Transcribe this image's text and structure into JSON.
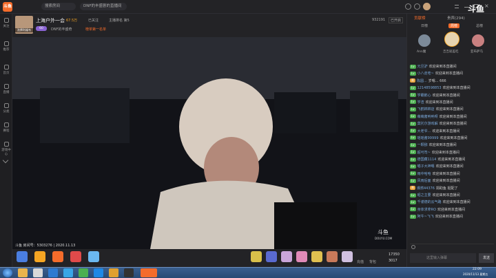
{
  "topbar": {
    "brand": "斗鱼",
    "search_placeholder": "搜索房间",
    "tabs": [
      "DNF的丰盛剧的直播间",
      "斗鱼"
    ],
    "right_icons": [
      "gamepad-icon",
      "bell-icon",
      "clock-icon",
      "share-icon"
    ]
  },
  "sidebar": {
    "items": [
      {
        "label": "关注",
        "icon": "heart-icon"
      },
      {
        "label": "推荐",
        "icon": "star-icon"
      },
      {
        "label": "首页",
        "icon": "home-icon"
      },
      {
        "label": "直播",
        "icon": "tv-icon"
      },
      {
        "label": "分类",
        "icon": "grid-icon"
      },
      {
        "label": "赛程",
        "icon": "calendar-icon"
      },
      {
        "label": "游戏中心",
        "icon": "gamepad-icon"
      }
    ]
  },
  "room": {
    "title": "上海户外一会",
    "avatar_label": "洗牌利福韦",
    "level_badge": "60",
    "fans": "67.5万",
    "followers": "已关注",
    "category": "DNF的丰盛奇",
    "heat_label": "榜单第一名单",
    "extra": "主播排名 第5",
    "follow_btn": "关注",
    "resolution": "蓝光",
    "stats": "932191",
    "quality": "已开启"
  },
  "video": {
    "watermark": "斗鱼",
    "watermark_sub": "DOUYU.COM",
    "room_line": "斗鱼 房间号：5303276 | 2020.11.13"
  },
  "bottom": {
    "gifts_left": [
      "热度",
      "热榜",
      "宝箱",
      "神秘人",
      "充值礼包"
    ],
    "coins": "17350",
    "coins2": "3017",
    "recharge": "充值",
    "backpack": "背包"
  },
  "right": {
    "logo": "斗鱼",
    "logo_sub": "DOUYU.COM",
    "tabs": [
      "贡献榜",
      "贵宾(294)"
    ],
    "sub_tabs": [
      "日榜",
      "周榜",
      "总榜"
    ],
    "top3": [
      {
        "name": "Ann魔",
        "rank": "1"
      },
      {
        "name": "吉吉就差吃",
        "rank": "2"
      },
      {
        "name": "亚布萨乌",
        "rank": "3"
      }
    ],
    "chat": [
      {
        "badge": "Lv",
        "color": "#4caf50",
        "name": "元旦驴",
        "text": "欢迎来到本直播间"
      },
      {
        "badge": "Lv",
        "color": "#4caf50",
        "name": "小八走哇~",
        "text": "欢迎来到本直播间"
      },
      {
        "badge": "贵",
        "color": "#e6a23c",
        "name": "陈圆...",
        "text": "岁嗯... 666"
      },
      {
        "badge": "Lv",
        "color": "#4caf50",
        "name": "12148598853",
        "text": "欢迎来到本直播间"
      },
      {
        "badge": "Lv",
        "color": "#4caf50",
        "name": "学霸鹅心",
        "text": "欢迎来到本直播间"
      },
      {
        "badge": "Lv",
        "color": "#4caf50",
        "name": "学渣",
        "text": "欢迎来到本直播间"
      },
      {
        "badge": "Lv",
        "color": "#4caf50",
        "name": "飞鹤棉棉店",
        "text": "欢迎来到本直播间"
      },
      {
        "badge": "Lv",
        "color": "#4caf50",
        "name": "萌萌酱呐呐呀",
        "text": "欢迎来到本直播间"
      },
      {
        "badge": "Lv",
        "color": "#4caf50",
        "name": "莫托尔游戏解",
        "text": "欢迎来到本直播间"
      },
      {
        "badge": "Lv",
        "color": "#4caf50",
        "name": "大老爷...",
        "text": "欢迎来到本直播间"
      },
      {
        "badge": "Lv",
        "color": "#4caf50",
        "name": "瑶瑶酱99999",
        "text": "欢迎来到本直播间"
      },
      {
        "badge": "Lv",
        "color": "#4caf50",
        "name": "一颗猕",
        "text": "欢迎来到本直播间"
      },
      {
        "badge": "Lv",
        "color": "#4caf50",
        "name": "超可司~",
        "text": "欢迎来到本直播间"
      },
      {
        "badge": "Lv",
        "color": "#4caf50",
        "name": "德国藏1114",
        "text": "欢迎来到本直播间"
      },
      {
        "badge": "Lv",
        "color": "#4caf50",
        "name": "喵子大神嗯",
        "text": "欢迎来到本直播间"
      },
      {
        "badge": "Lv",
        "color": "#4caf50",
        "name": "雨中哈哈",
        "text": "欢迎来到本直播间"
      },
      {
        "badge": "Lv",
        "color": "#4caf50",
        "name": "风雨后面",
        "text": "欢迎来到本直播间"
      },
      {
        "badge": "贵",
        "color": "#e6a23c",
        "name": "爆燃44376",
        "text": "捐助鱼 挺配了"
      },
      {
        "badge": "Lv",
        "color": "#4caf50",
        "name": "昭之主要",
        "text": "欢迎来到本直播间"
      },
      {
        "badge": "Lv",
        "color": "#4caf50",
        "name": "千谨德的云气路",
        "text": "欢迎来到本直播间"
      },
      {
        "badge": "Lv",
        "color": "#4caf50",
        "name": "身体求拿RO",
        "text": "欢迎来到本直播间"
      },
      {
        "badge": "Lv",
        "color": "#4caf50",
        "name": "阿牛~飞飞",
        "text": "欢迎来到本直播间"
      }
    ],
    "input_placeholder": "这里输入弹幕",
    "send": "发送"
  },
  "taskbar": {
    "time": "22:09",
    "date": "2020/11/13 星期五"
  },
  "colors": {
    "accent": "#f56c2b",
    "brand": "#ff7f00"
  }
}
